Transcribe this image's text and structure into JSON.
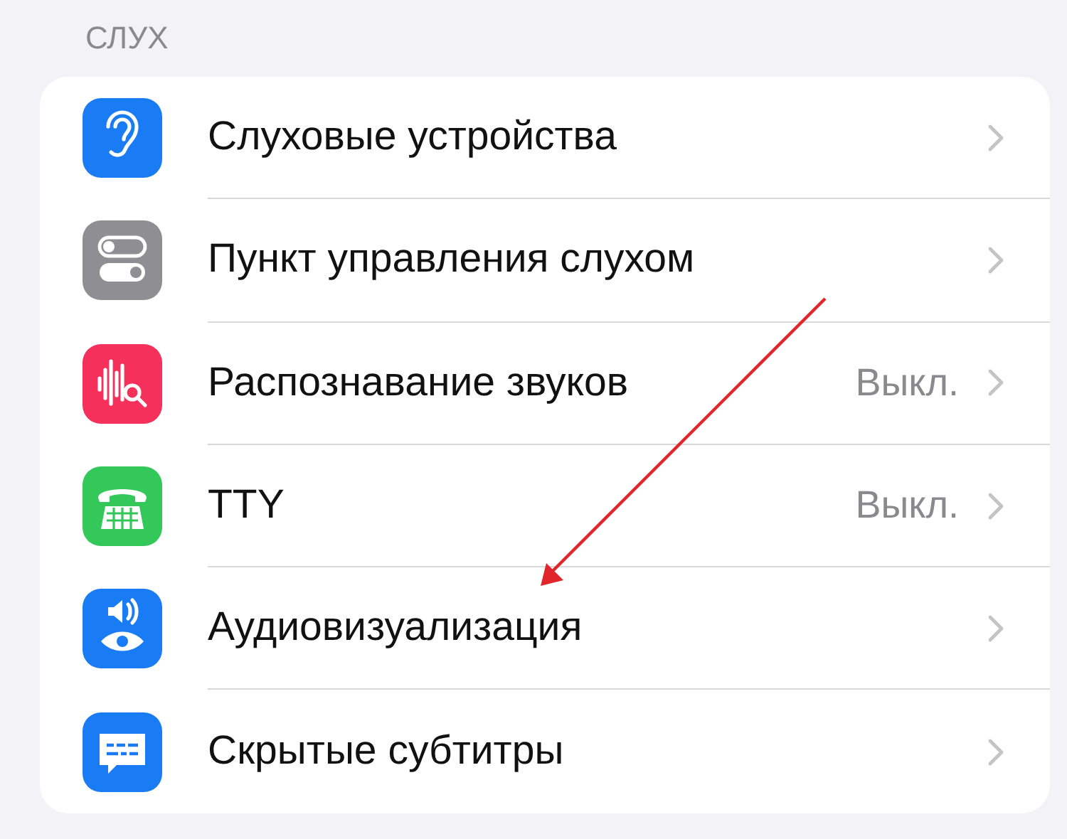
{
  "section": {
    "header": "СЛУХ"
  },
  "items": [
    {
      "label": "Слуховые устройства",
      "kind": "ear",
      "color": "#1a7cf5"
    },
    {
      "label": "Пункт управления слухом",
      "kind": "toggles",
      "color": "#8e8e93"
    },
    {
      "label": "Распознавание звуков",
      "value": "Выкл.",
      "kind": "sound-search",
      "color": "#f5305a"
    },
    {
      "label": "TTY",
      "value": "Выкл.",
      "kind": "tty",
      "color": "#34c759"
    },
    {
      "label": "Аудиовизуализация",
      "kind": "audio-visual",
      "color": "#1a7cf5"
    },
    {
      "label": "Скрытые субтитры",
      "kind": "captions",
      "color": "#1a7cf5"
    }
  ],
  "annotations": [
    {
      "kind": "arrow"
    }
  ]
}
